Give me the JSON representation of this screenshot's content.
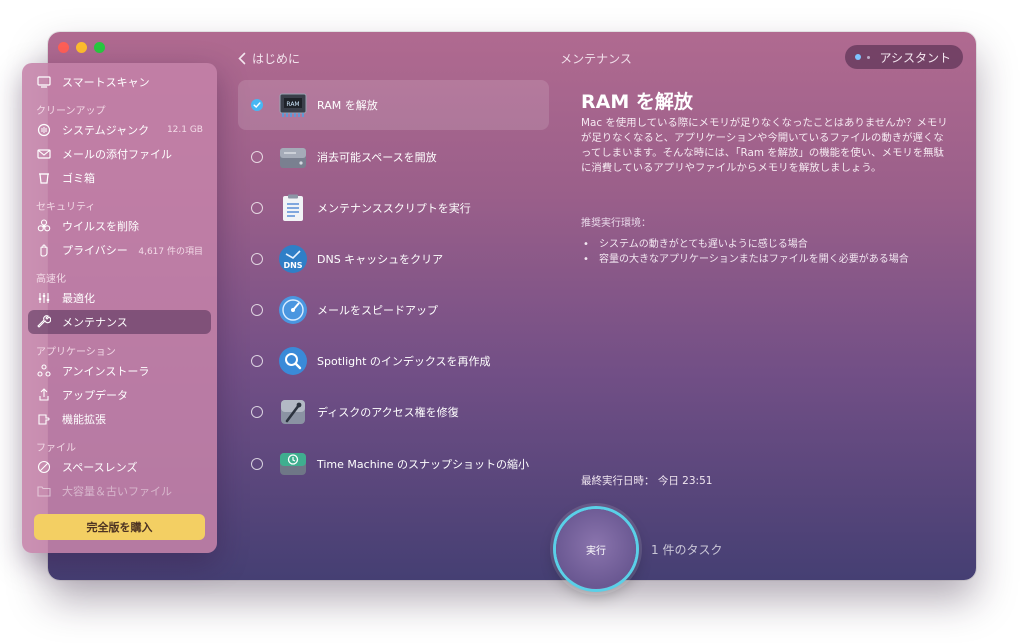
{
  "window": {
    "title": "メンテナンス",
    "back_label": "はじめに",
    "assistant_label": "アシスタント"
  },
  "sidebar": {
    "smart_scan": "スマートスキャン",
    "sections": {
      "cleanup": "クリーンアップ",
      "security": "セキュリティ",
      "speed": "高速化",
      "apps": "アプリケーション",
      "files": "ファイル"
    },
    "items": {
      "system_junk": {
        "label": "システムジャンク",
        "meta": "12.1 GB"
      },
      "mail_attachments": {
        "label": "メールの添付ファイル"
      },
      "trash": {
        "label": "ゴミ箱"
      },
      "malware": {
        "label": "ウイルスを削除"
      },
      "privacy": {
        "label": "プライバシー",
        "meta": "4,617 件の項目"
      },
      "optimization": {
        "label": "最適化"
      },
      "maintenance": {
        "label": "メンテナンス"
      },
      "uninstaller": {
        "label": "アンインストーラ"
      },
      "updater": {
        "label": "アップデータ"
      },
      "extensions": {
        "label": "機能拡張"
      },
      "space_lens": {
        "label": "スペースレンズ"
      },
      "large_old": {
        "label": "大容量＆古いファイル"
      }
    },
    "buy_button": "完全版を購入"
  },
  "tasks": [
    {
      "label": "RAM を解放",
      "checked": true
    },
    {
      "label": "消去可能スペースを開放",
      "checked": false
    },
    {
      "label": "メンテナンススクリプトを実行",
      "checked": false
    },
    {
      "label": "DNS キャッシュをクリア",
      "checked": false
    },
    {
      "label": "メールをスピードアップ",
      "checked": false
    },
    {
      "label": "Spotlight のインデックスを再作成",
      "checked": false
    },
    {
      "label": "ディスクのアクセス権を修復",
      "checked": false
    },
    {
      "label": "Time Machine のスナップショットの縮小",
      "checked": false
    }
  ],
  "detail": {
    "title": "RAM を解放",
    "description": "Mac を使用している際にメモリが足りなくなったことはありませんか？メモリが足りなくなると、アプリケーションや今開いているファイルの動きが遅くなってしまいます。そんな時には、「Ram を解放」の機能を使い、メモリを無駄に消費しているアプリやファイルからメモリを解放しましょう。",
    "recommended_heading": "推奨実行環境：",
    "recommended": [
      "システムの動きがとても遅いように感じる場合",
      "容量の大きなアプリケーションまたはファイルを開く必要がある場合"
    ],
    "last_run": "最終実行日時：  今日 23:51"
  },
  "run": {
    "button_label": "実行",
    "task_count": "1 件のタスク"
  },
  "icons": {
    "ram_chip_label": "RAM",
    "dns_label": "DNS"
  },
  "colors": {
    "accent_blue": "#47b7f3",
    "buy_yellow": "#f3cf63",
    "run_ring": "#5ad0e8"
  }
}
